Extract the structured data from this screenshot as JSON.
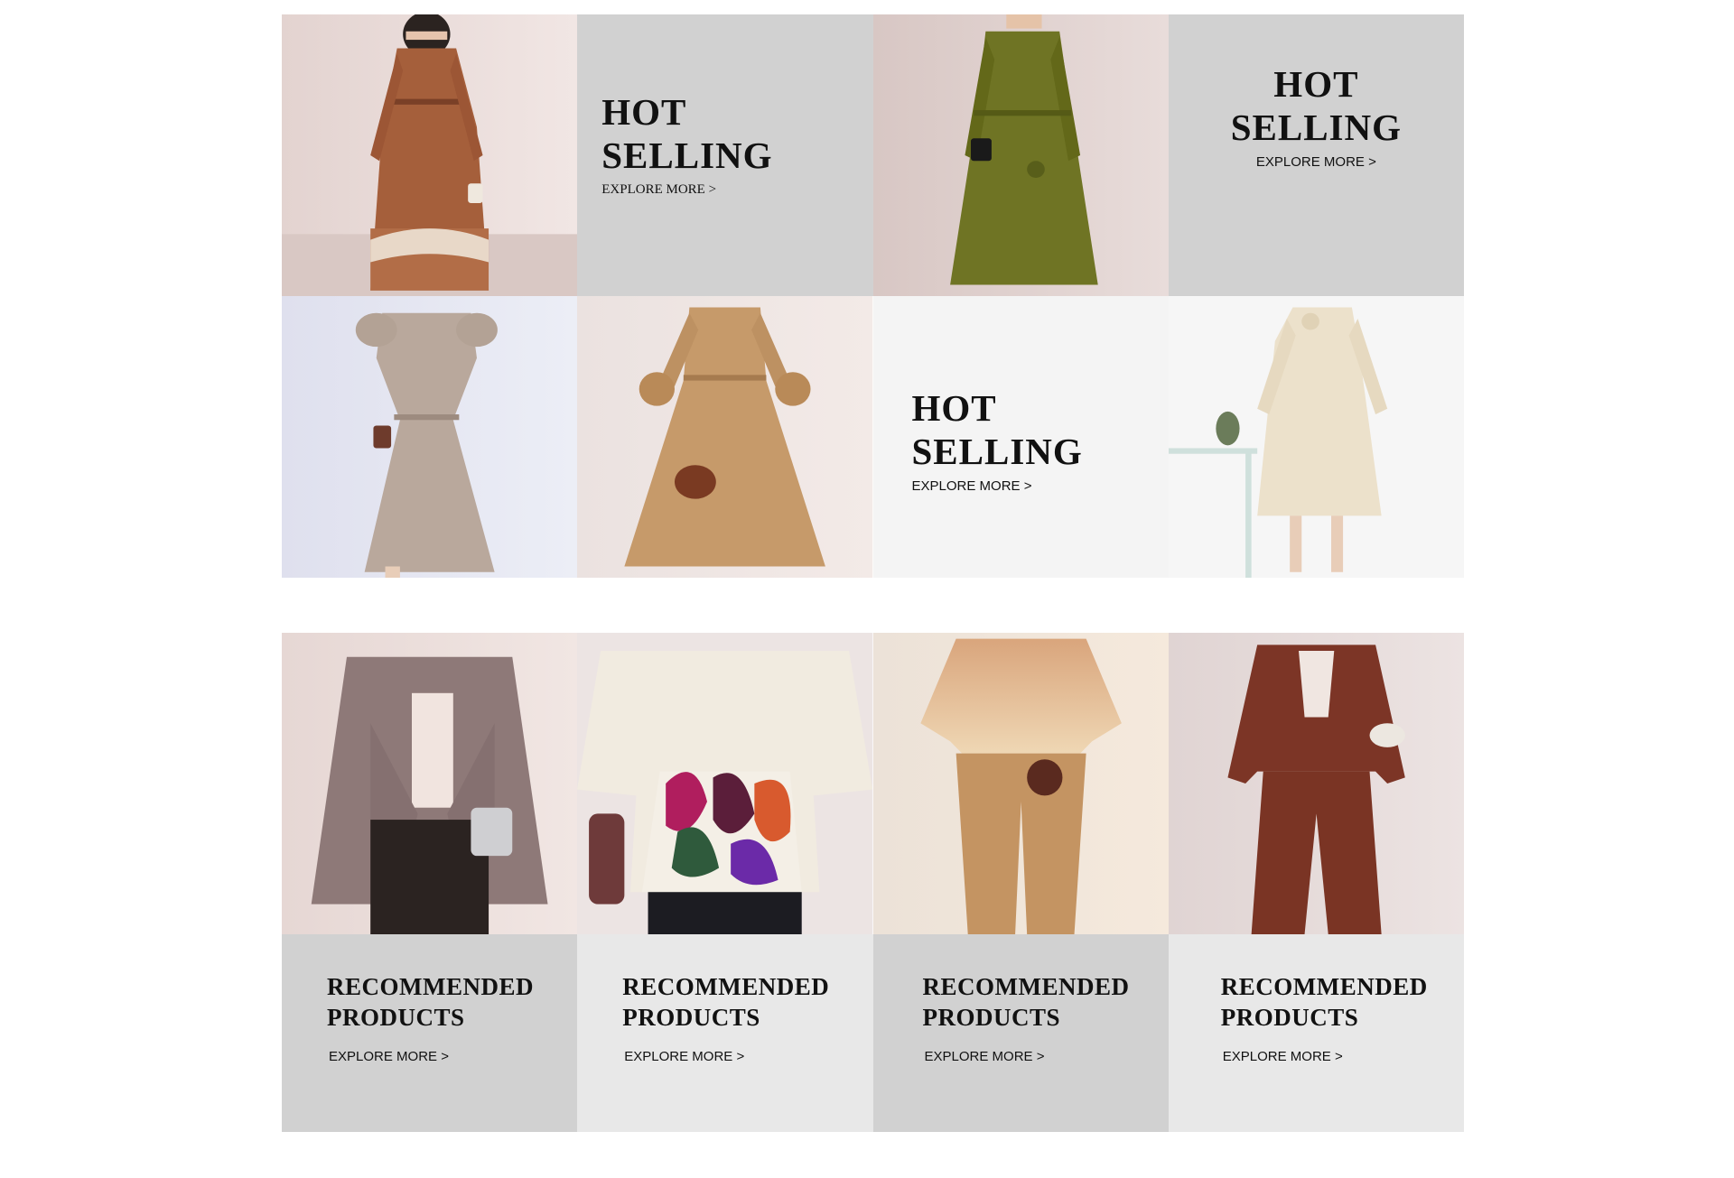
{
  "colors": {
    "panel_gray": "#d1d1d1",
    "panel_light": "#f4f4f4",
    "panel_rec_light": "#e8e8e8",
    "text": "#111111"
  },
  "hot_selling": {
    "promo_1": {
      "title_line1": "HOT",
      "title_line2": "SELLING",
      "link": "EXPLORE MORE >"
    },
    "promo_2": {
      "title_line1": "HOT",
      "title_line2": "SELLING",
      "link": "EXPLORE MORE >"
    },
    "promo_3": {
      "title_line1": "HOT",
      "title_line2": "SELLING",
      "link": "EXPLORE MORE >"
    },
    "products": [
      {
        "image": "rust-pleated-shirt-dress"
      },
      {
        "image": "olive-green-pleated-dress"
      },
      {
        "image": "taupe-puff-sleeve-dress"
      },
      {
        "image": "camel-ruffle-sleeve-dress"
      },
      {
        "image": "cream-flower-sleeve-dress"
      }
    ]
  },
  "recommended": {
    "items": [
      {
        "image": "mauve-fringe-cardigan",
        "title_line1": "RECOMMENDED",
        "title_line2": "PRODUCTS",
        "link": "EXPLORE MORE >"
      },
      {
        "image": "floral-embroidered-top",
        "title_line1": "RECOMMENDED",
        "title_line2": "PRODUCTS",
        "link": "EXPLORE MORE >"
      },
      {
        "image": "ombre-top-camel-trousers",
        "title_line1": "RECOMMENDED",
        "title_line2": "PRODUCTS",
        "link": "EXPLORE MORE >"
      },
      {
        "image": "burgundy-pleated-suit",
        "title_line1": "RECOMMENDED",
        "title_line2": "PRODUCTS",
        "link": "EXPLORE MORE >"
      }
    ]
  }
}
